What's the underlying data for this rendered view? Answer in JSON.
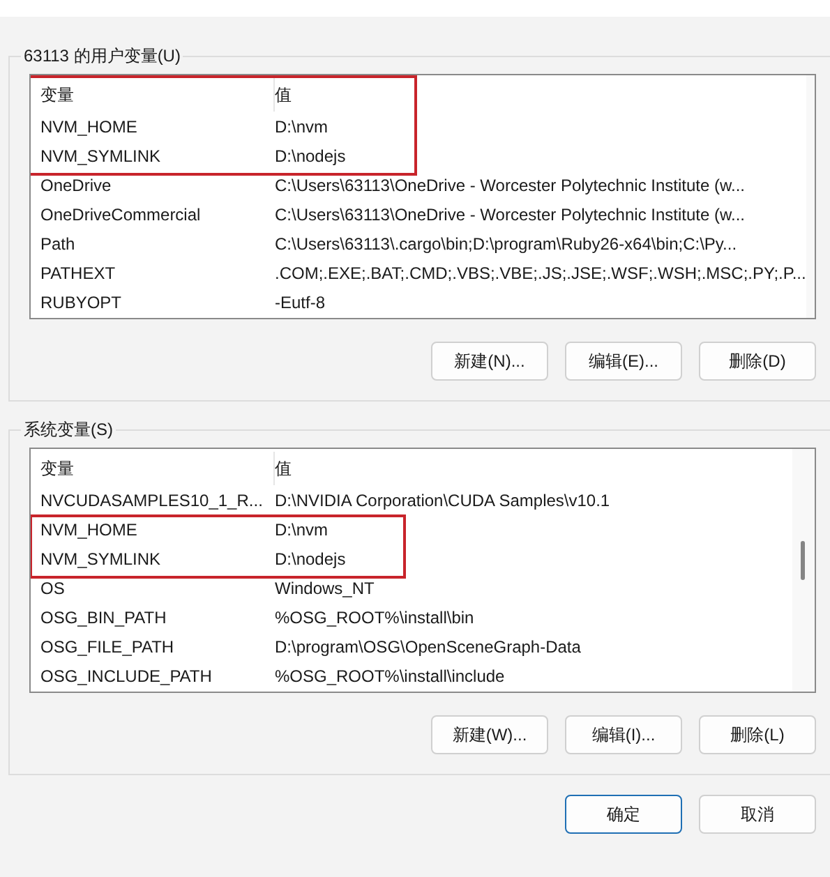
{
  "user_variables": {
    "legend": "63113 的用户变量(U)",
    "columns": [
      {
        "label": "变量"
      },
      {
        "label": "值"
      }
    ],
    "header_highlighted": true,
    "rows": [
      {
        "name": "NVM_HOME",
        "value": "D:\\nvm",
        "highlighted": true
      },
      {
        "name": "NVM_SYMLINK",
        "value": "D:\\nodejs",
        "highlighted": true
      },
      {
        "name": "OneDrive",
        "value": "C:\\Users\\63113\\OneDrive - Worcester Polytechnic Institute (w...",
        "highlighted": false
      },
      {
        "name": "OneDriveCommercial",
        "value": "C:\\Users\\63113\\OneDrive - Worcester Polytechnic Institute (w...",
        "highlighted": false
      },
      {
        "name": "Path",
        "value": "C:\\Users\\63113\\.cargo\\bin;D:\\program\\Ruby26-x64\\bin;C:\\Py...",
        "highlighted": false
      },
      {
        "name": "PATHEXT",
        "value": ".COM;.EXE;.BAT;.CMD;.VBS;.VBE;.JS;.JSE;.WSF;.WSH;.MSC;.PY;.P...",
        "highlighted": false
      },
      {
        "name": "RUBYOPT",
        "value": "-Eutf-8",
        "highlighted": false
      }
    ],
    "buttons": [
      {
        "label": "新建(N)..."
      },
      {
        "label": "编辑(E)..."
      },
      {
        "label": "删除(D)"
      }
    ]
  },
  "system_variables": {
    "legend": "系统变量(S)",
    "columns": [
      {
        "label": "变量"
      },
      {
        "label": "值"
      }
    ],
    "header_highlighted": false,
    "rows": [
      {
        "name": "NVCUDASAMPLES10_1_R...",
        "value": "D:\\NVIDIA Corporation\\CUDA Samples\\v10.1",
        "highlighted": false
      },
      {
        "name": "NVM_HOME",
        "value": "D:\\nvm",
        "highlighted": true
      },
      {
        "name": "NVM_SYMLINK",
        "value": "D:\\nodejs",
        "highlighted": true
      },
      {
        "name": "OS",
        "value": "Windows_NT",
        "highlighted": false
      },
      {
        "name": "OSG_BIN_PATH",
        "value": "%OSG_ROOT%\\install\\bin",
        "highlighted": false
      },
      {
        "name": "OSG_FILE_PATH",
        "value": "D:\\program\\OSG\\OpenSceneGraph-Data",
        "highlighted": false
      },
      {
        "name": "OSG_INCLUDE_PATH",
        "value": "%OSG_ROOT%\\install\\include",
        "highlighted": false
      }
    ],
    "buttons": [
      {
        "label": "新建(W)..."
      },
      {
        "label": "编辑(I)..."
      },
      {
        "label": "删除(L)"
      }
    ]
  },
  "dialog_buttons": [
    {
      "label": "确定",
      "default": true
    },
    {
      "label": "取消",
      "default": false
    }
  ]
}
